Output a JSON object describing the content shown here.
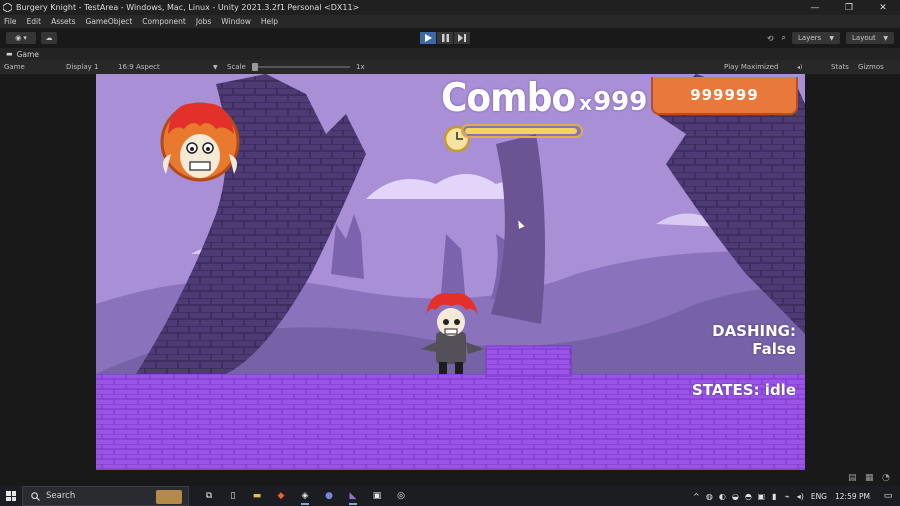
{
  "window": {
    "title": "Burgery Knight - TestArea - Windows, Mac, Linux - Unity 2021.3.2f1 Personal <DX11>",
    "minimize_icon": "minimize-icon",
    "maximize_icon": "restore-icon",
    "close_icon": "close-icon"
  },
  "menu": [
    "File",
    "Edit",
    "Assets",
    "GameObject",
    "Component",
    "Jobs",
    "Window",
    "Help"
  ],
  "toolbar": {
    "layers_label": "Layers",
    "layout_label": "Layout"
  },
  "game_tab": {
    "label": "Game"
  },
  "game_controls": {
    "view_label": "Game",
    "display_label": "Display 1",
    "aspect_label": "16:9 Aspect",
    "scale_label": "Scale",
    "scale_value": "1x",
    "play_mode_label": "Play Maximized",
    "stats_label": "Stats",
    "gizmos_label": "Gizmos"
  },
  "hud": {
    "combo_word": "Combo",
    "combo_x": "x",
    "combo_count": "999",
    "score": "999999",
    "combo_timer": 0.98,
    "dashing_label": "DASHING:",
    "dashing_value": "False",
    "states_label": "STATES: idle"
  },
  "colors": {
    "sky": "#a98fd6",
    "tower": "#4e3a74",
    "ground": "#9b54e8",
    "score_panel": "#e9793b",
    "accent_blue": "#3a6ba8"
  },
  "taskbar": {
    "search_placeholder": "Search",
    "language": "ENG",
    "time": "12:59 PM"
  }
}
